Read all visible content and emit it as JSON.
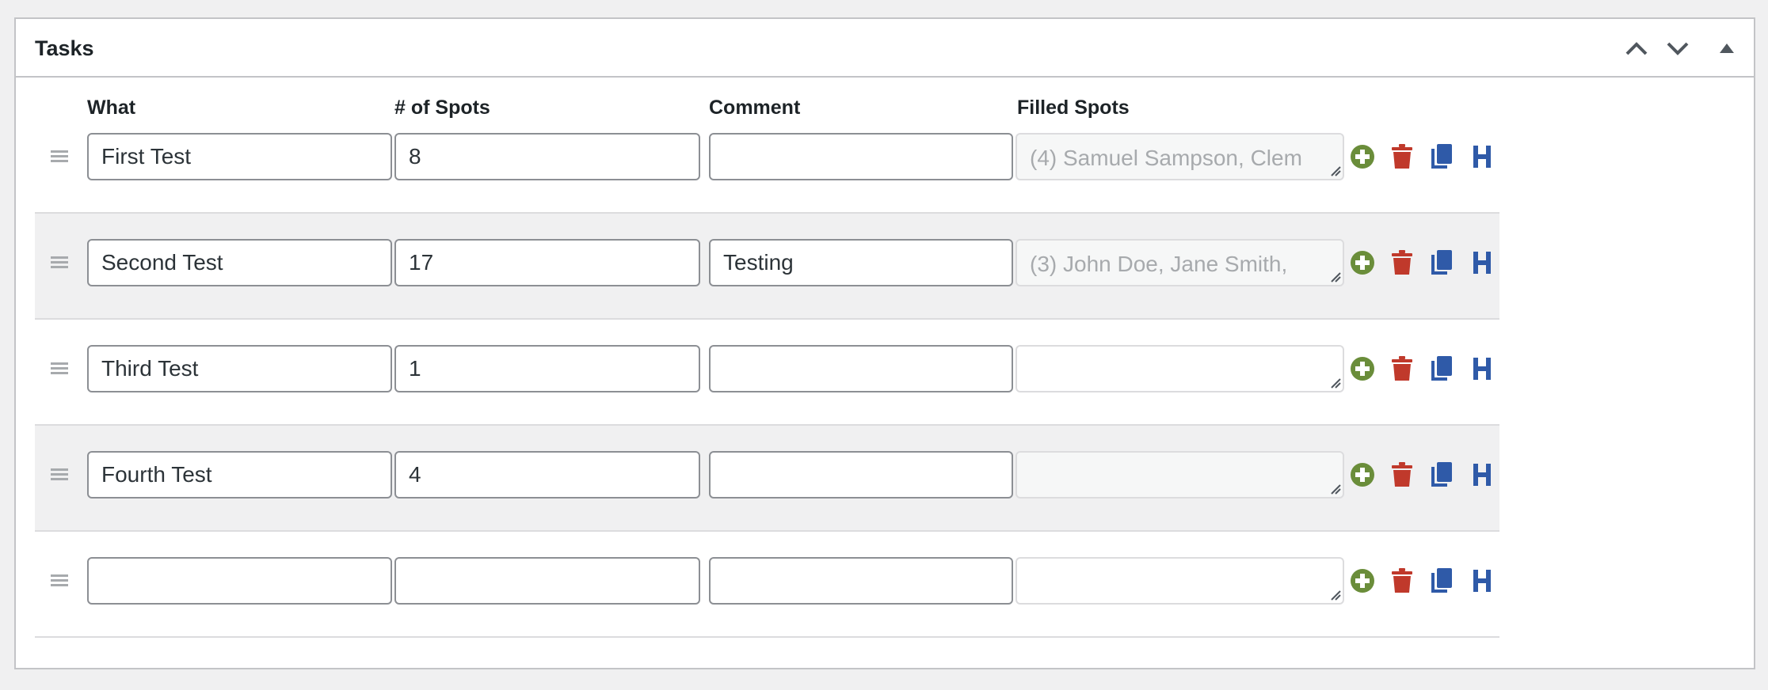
{
  "panel": {
    "title": "Tasks",
    "controls": [
      "move-up",
      "move-down",
      "toggle-panel"
    ]
  },
  "columns": {
    "what": "What",
    "spots": "# of Spots",
    "comment": "Comment",
    "filled": "Filled Spots"
  },
  "tasks": [
    {
      "what": "First Test",
      "spots": "8",
      "comment": "",
      "filled": "(4) Samuel Sampson, Clem"
    },
    {
      "what": "Second Test",
      "spots": "17",
      "comment": "Testing",
      "filled": "(3) John Doe, Jane Smith,"
    },
    {
      "what": "Third Test",
      "spots": "1",
      "comment": "",
      "filled": ""
    },
    {
      "what": "Fourth Test",
      "spots": "4",
      "comment": "",
      "filled": ""
    },
    {
      "what": "",
      "spots": "",
      "comment": "",
      "filled": ""
    }
  ],
  "row_actions": [
    "add-icon",
    "trash-icon",
    "copy-icon",
    "header-icon"
  ],
  "colors": {
    "add": "#6a8d3a",
    "delete": "#c0392b",
    "copy": "#2f5aa8",
    "header": "#2f5aa8",
    "alt_row": "#f0f0f1"
  }
}
